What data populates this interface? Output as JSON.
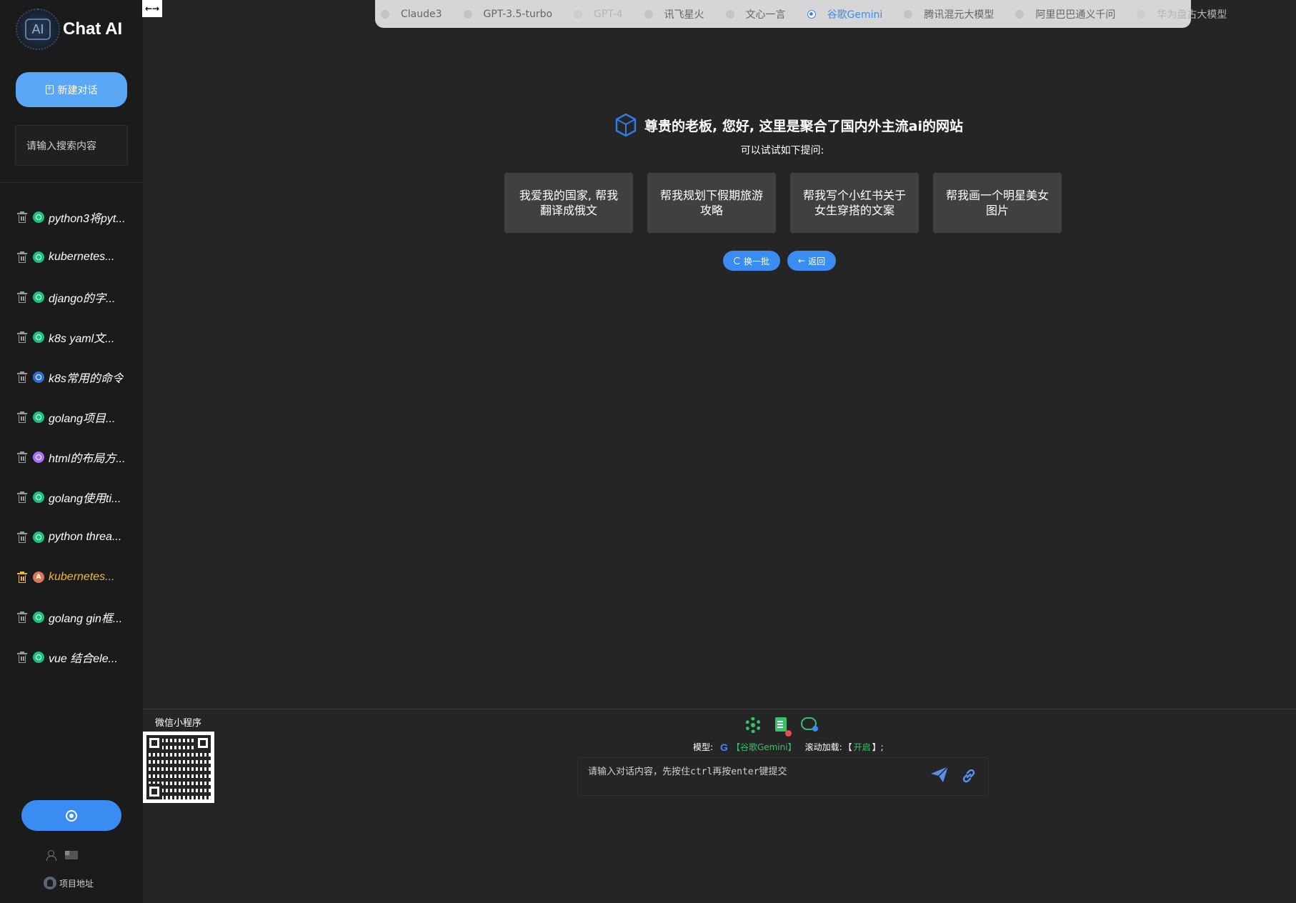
{
  "brand": {
    "logo_text": "AI",
    "title": "Chat AI"
  },
  "sidebar": {
    "new_chat_label": "新建对话",
    "search_placeholder": "请输入搜索内容",
    "history": [
      {
        "title": "python3将pyt...",
        "icon": "openai-icon",
        "color": "#19c37d"
      },
      {
        "title": "kubernetes...",
        "icon": "openai-icon",
        "color": "#19c37d"
      },
      {
        "title": "django的字...",
        "icon": "openai-icon",
        "color": "#19c37d"
      },
      {
        "title": "k8s yaml文...",
        "icon": "openai-icon",
        "color": "#19c37d"
      },
      {
        "title": "k8s常用的命令",
        "icon": "flame-icon",
        "color": "#2f6fd8"
      },
      {
        "title": "golang项目...",
        "icon": "openai-icon",
        "color": "#19c37d"
      },
      {
        "title": "html的布局方...",
        "icon": "openai-icon",
        "color": "#a970ff"
      },
      {
        "title": "golang使用ti...",
        "icon": "openai-icon",
        "color": "#19c37d"
      },
      {
        "title": "python threa...",
        "icon": "openai-icon",
        "color": "#19c37d"
      },
      {
        "title": "kubernetes...",
        "icon": "anthropic-icon",
        "color": "#d97757",
        "active": true
      },
      {
        "title": "golang gin框...",
        "icon": "openai-icon",
        "color": "#19c37d"
      },
      {
        "title": "vue 结合ele...",
        "icon": "openai-icon",
        "color": "#19c37d"
      }
    ],
    "project_link": "项目地址"
  },
  "model_tabs": [
    {
      "label": "Claude3",
      "state": "normal"
    },
    {
      "label": "GPT-3.5-turbo",
      "state": "normal"
    },
    {
      "label": "GPT-4",
      "state": "disabled"
    },
    {
      "label": "讯飞星火",
      "state": "normal"
    },
    {
      "label": "文心一言",
      "state": "normal"
    },
    {
      "label": "谷歌Gemini",
      "state": "selected"
    },
    {
      "label": "腾讯混元大模型",
      "state": "normal"
    },
    {
      "label": "阿里巴巴通义千问",
      "state": "normal"
    },
    {
      "label": "华为盘古大模型",
      "state": "disabled"
    }
  ],
  "welcome": {
    "title": "尊贵的老板, 您好, 这里是聚合了国内外主流ai的网站",
    "subtitle": "可以试试如下提问:",
    "suggestions": [
      "我爱我的国家, 帮我翻译成俄文",
      "帮我规划下假期旅游攻略",
      "帮我写个小红书关于女生穿搭的文案",
      "帮我画一个明星美女图片"
    ],
    "refresh_label": "换一批",
    "back_label": "返回"
  },
  "mini_program": {
    "title": "微信小程序"
  },
  "status": {
    "model_label": "模型:",
    "model_value": "【谷歌Gemini】",
    "scroll_label": "滚动加载:",
    "scroll_value_open": "【",
    "scroll_value": "开启",
    "scroll_value_close": "】;"
  },
  "chat_input": {
    "placeholder": "请输入对话内容，先按住ctrl再按enter键提交"
  },
  "colors": {
    "accent": "#3b8cf2",
    "green": "#37c16b",
    "active": "#f2b632"
  }
}
